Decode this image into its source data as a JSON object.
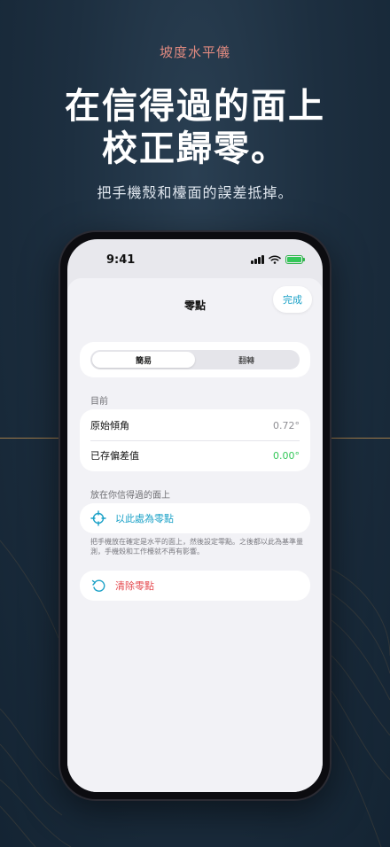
{
  "promo": {
    "eyebrow": "坡度水平儀",
    "headline_line1": "在信得過的面上",
    "headline_line2": "校正歸零。",
    "subline": "把手機殼和檯面的誤差抵掉。"
  },
  "status_bar": {
    "time": "9:41"
  },
  "sheet": {
    "title": "零點",
    "done_label": "完成",
    "segments": [
      "簡易",
      "翻轉"
    ],
    "selected_segment": "簡易",
    "current": {
      "section_label": "目前",
      "rows": [
        {
          "label": "原始傾角",
          "value": "0.72°"
        },
        {
          "label": "已存偏差值",
          "value": "0.00°"
        }
      ]
    },
    "place": {
      "section_label": "放在你信得過的面上",
      "set_zero_label": "以此處為零點",
      "hint": "把手機放在確定是水平的面上，然後設定零點。之後都以此為基準量測，手機殼和工作檯就不再有影響。"
    },
    "clear_zero_label": "清除零點"
  },
  "colors": {
    "accent": "#1aa1c7",
    "destructive": "#e5484d",
    "positive": "#34c759",
    "eyebrow": "#e08a80",
    "gold_line": "#b98a4c"
  },
  "icons": {
    "set_zero": "crosshair-icon",
    "clear_zero": "counterclockwise-arrow-icon"
  }
}
